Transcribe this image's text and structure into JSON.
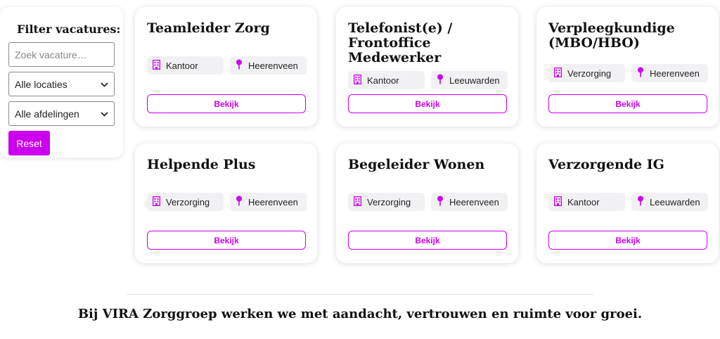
{
  "filters": {
    "title": "Filter vacatures:",
    "search_placeholder": "Zoek vacature…",
    "location_select": "Alle locaties",
    "department_select": "Alle afdelingen",
    "reset_label": "Reset"
  },
  "icons": {
    "department": "building-icon",
    "location": "map-pin-icon",
    "dropdown": "chevron-down-icon"
  },
  "colors": {
    "accent": "#cc00ee",
    "tag_bg": "#f1f1f3"
  },
  "jobs": [
    {
      "title": "Teamleider Zorg",
      "department": "Kantoor",
      "location": "Heerenveen",
      "button": "Bekijk"
    },
    {
      "title": "Telefonist(e) / Frontoffice Medewerker",
      "department": "Kantoor",
      "location": "Leeuwarden",
      "button": "Bekijk"
    },
    {
      "title": "Verpleegkundige (MBO/HBO)",
      "department": "Verzorging",
      "location": "Heerenveen",
      "button": "Bekijk"
    },
    {
      "title": "Helpende Plus",
      "department": "Verzorging",
      "location": "Heerenveen",
      "button": "Bekijk"
    },
    {
      "title": "Begeleider Wonen",
      "department": "Verzorging",
      "location": "Heerenveen",
      "button": "Bekijk"
    },
    {
      "title": "Verzorgende IG",
      "department": "Kantoor",
      "location": "Leeuwarden",
      "button": "Bekijk"
    }
  ],
  "footer": {
    "tagline": "Bij VIRA Zorggroep werken we met aandacht, vertrouwen en ruimte voor groei."
  }
}
